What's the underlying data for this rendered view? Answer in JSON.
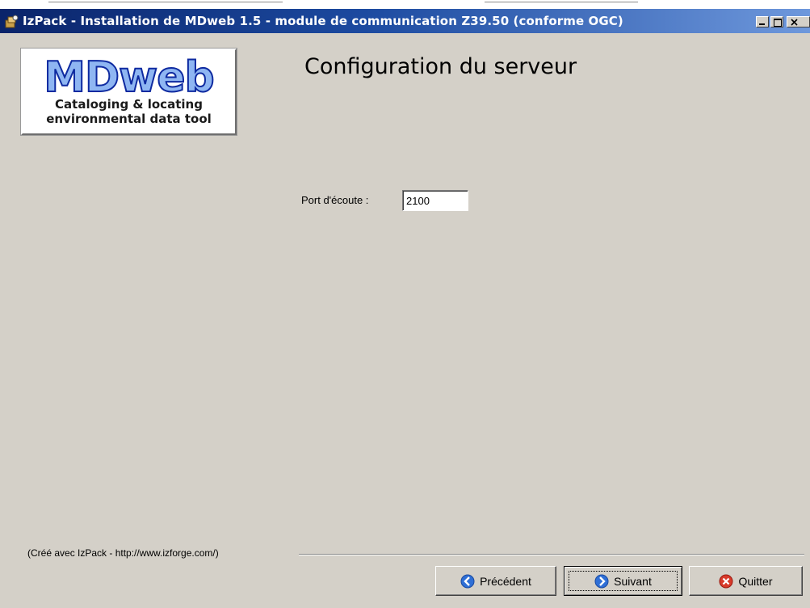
{
  "window": {
    "title": "IzPack - Installation de MDweb 1.5 - module de communication Z39.50 (conforme OGC)"
  },
  "logo": {
    "brand": "MDweb",
    "tagline_line1": "Cataloging & locating",
    "tagline_line2": "environmental data tool"
  },
  "panel": {
    "heading": "Configuration du serveur",
    "port_label": "Port d'écoute :",
    "port_value": "2100"
  },
  "footer": {
    "credit": "(Créé avec IzPack - http://www.izforge.com/)"
  },
  "buttons": {
    "previous": "Précédent",
    "next": "Suivant",
    "quit": "Quitter"
  },
  "icons": {
    "app": "installer-package-icon",
    "previous": "arrow-left-circle-icon",
    "next": "arrow-right-circle-icon",
    "quit": "close-circle-icon"
  },
  "colors": {
    "window_bg": "#d4d0c8",
    "titlebar_start": "#0a246a",
    "titlebar_end": "#6e98dc",
    "nav_icon_blue": "#2f6fd6",
    "quit_icon_red": "#d83a2a"
  }
}
